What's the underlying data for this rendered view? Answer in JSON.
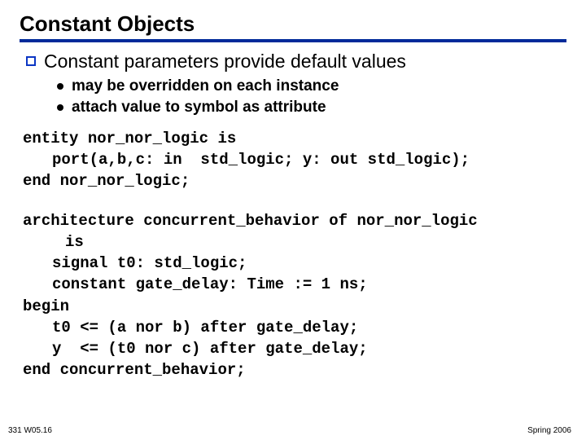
{
  "title": "Constant Objects",
  "bullets": {
    "main": "Constant parameters provide default values",
    "subs": [
      "may be overridden on each instance",
      "attach value to symbol as attribute"
    ]
  },
  "code1": {
    "l1": "entity nor_nor_logic is",
    "l2": "port(a,b,c: in  std_logic; y: out std_logic);",
    "l3": "end nor_nor_logic;"
  },
  "code2": {
    "l1": "architecture concurrent_behavior of nor_nor_logic",
    "l2": "is",
    "l3": "signal t0: std_logic;",
    "l4": "constant gate_delay: Time := 1 ns;",
    "l5": "begin",
    "l6": "t0 <= (a nor b) after gate_delay;",
    "l7": "y  <= (t0 nor c) after gate_delay;",
    "l8": "end concurrent_behavior;"
  },
  "footer": {
    "left": "331 W05.16",
    "right": "Spring 2006"
  }
}
